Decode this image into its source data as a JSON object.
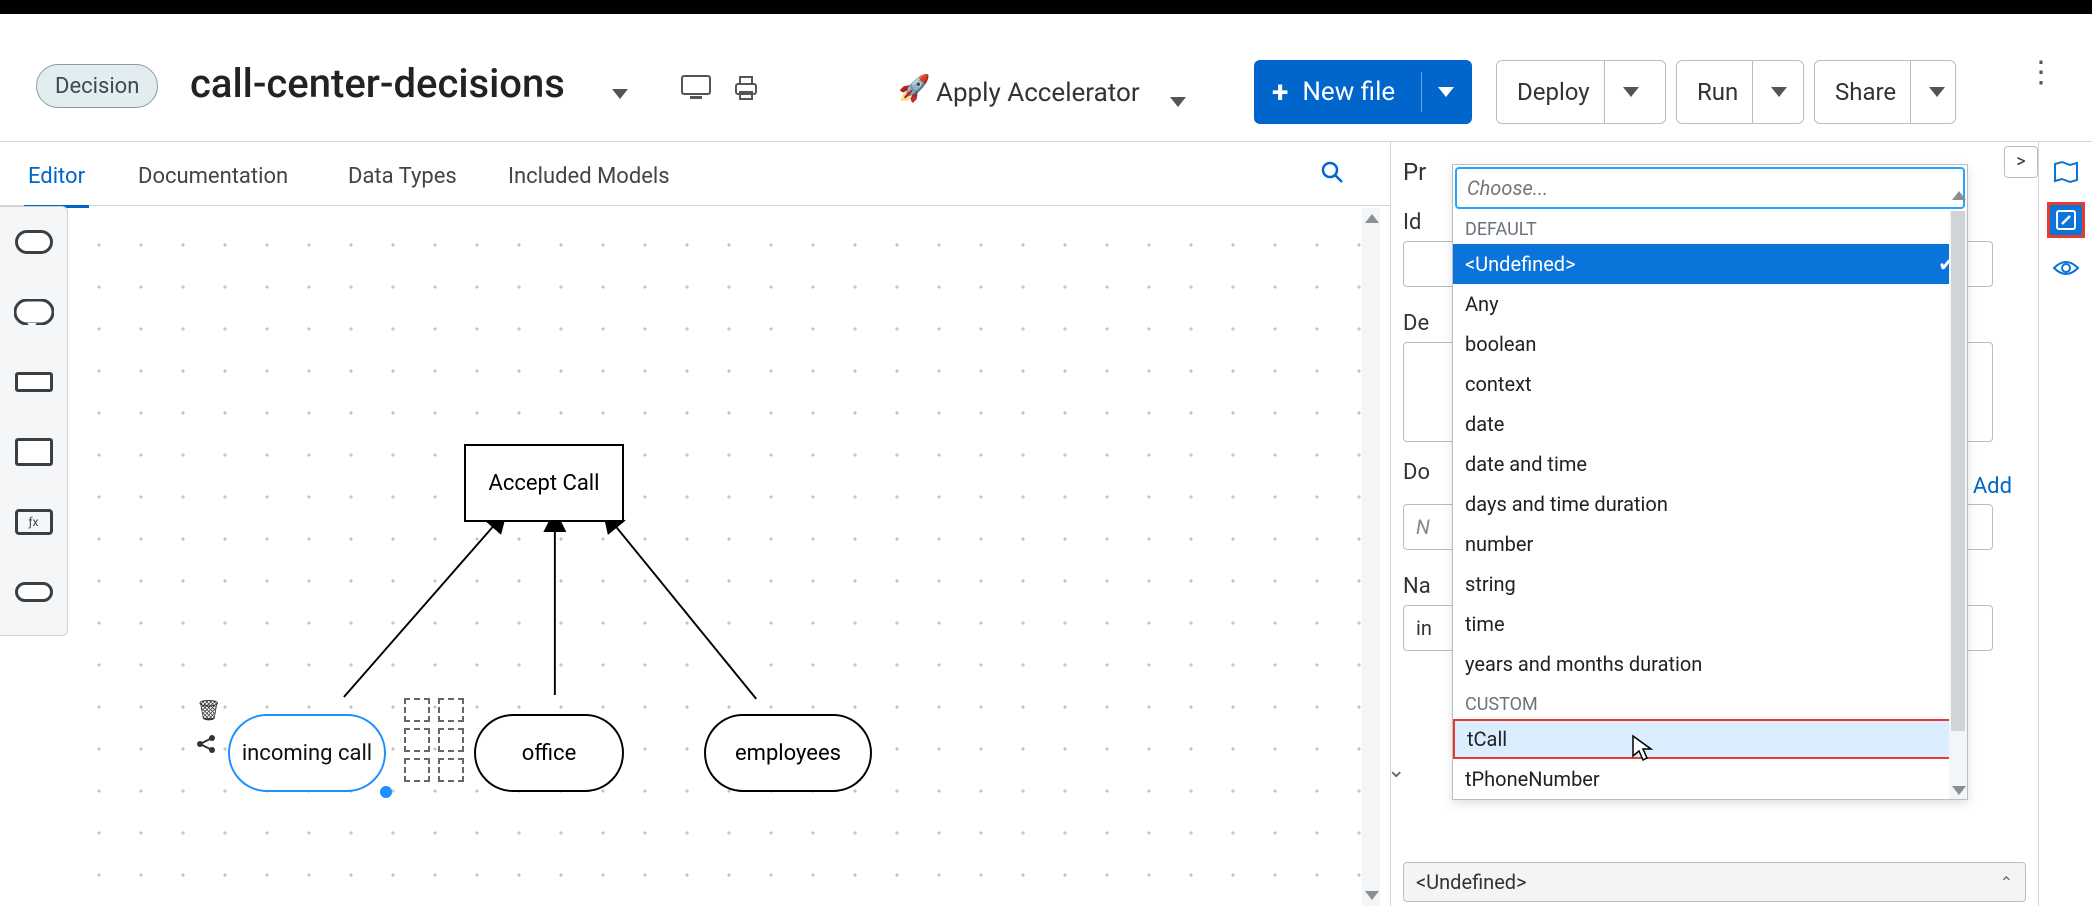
{
  "header": {
    "chip": "Decision",
    "title": "call-center-decisions",
    "accelerator": "Apply Accelerator",
    "new_file": "New file",
    "deploy": "Deploy",
    "run": "Run",
    "share": "Share"
  },
  "tabs": [
    "Editor",
    "Documentation",
    "Data Types",
    "Included Models"
  ],
  "activeTab": 0,
  "nodes": {
    "accept": "Accept Call",
    "incoming": "incoming call",
    "office": "office",
    "employees": "employees"
  },
  "properties": {
    "title_prefix": "Pr",
    "id_label": "Id",
    "desc_label": "De",
    "doc_label": "Do",
    "doc_placeholder_visible": "N",
    "name_label": "Na",
    "name_value_visible": "in",
    "add_link": "Add",
    "undef_row": "<Undefined>"
  },
  "dropdown": {
    "placeholder": "Choose...",
    "groups": [
      {
        "label": "DEFAULT",
        "items": [
          "<Undefined>",
          "Any",
          "boolean",
          "context",
          "date",
          "date and time",
          "days and time duration",
          "number",
          "string",
          "time",
          "years and months duration"
        ]
      },
      {
        "label": "CUSTOM",
        "items": [
          "tCall",
          "tPhoneNumber"
        ]
      }
    ],
    "selected": "<Undefined>",
    "highlighted": "tCall"
  }
}
